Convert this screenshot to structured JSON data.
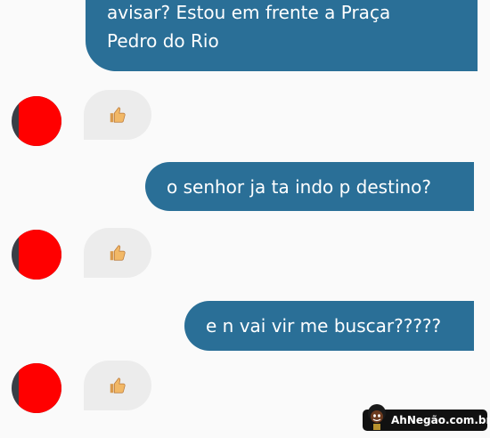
{
  "messages": {
    "out_1": "avisar? Estou em frente a Praça\nPedro do Rio",
    "out_2": "o senhor ja ta indo p destino?",
    "out_3": "e n vai vir me buscar?????",
    "reply_icon": "thumbs-up-icon"
  },
  "watermark": {
    "text": "AhNegão.com.br",
    "mascot_icon": "afro-mascot-icon"
  },
  "colors": {
    "outgoing_bubble": "#2a6f97",
    "incoming_bubble": "#ececec",
    "redaction": "#ff0000",
    "background": "#fafafa"
  }
}
